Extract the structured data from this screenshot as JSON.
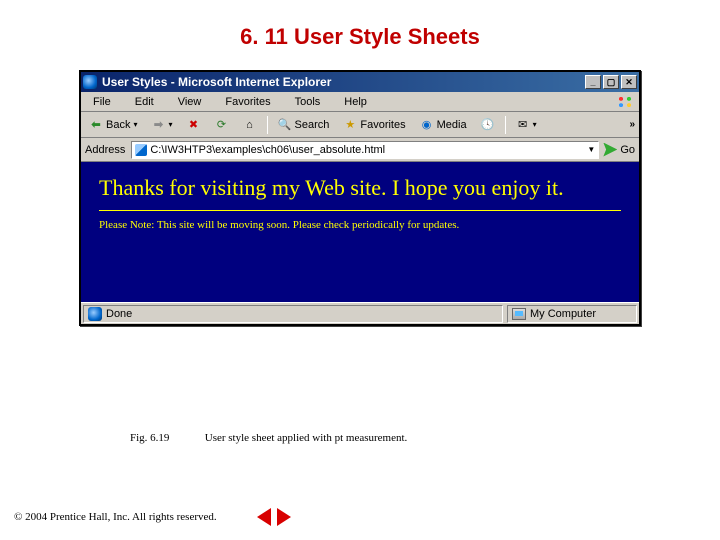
{
  "slide": {
    "title": "6. 11  User Style Sheets"
  },
  "browser": {
    "title": "User Styles - Microsoft Internet Explorer",
    "menus": [
      "File",
      "Edit",
      "View",
      "Favorites",
      "Tools",
      "Help"
    ],
    "toolbar": {
      "back": "Back",
      "search": "Search",
      "favorites": "Favorites",
      "media": "Media",
      "overflow": "»"
    },
    "address": {
      "label": "Address",
      "value": "C:\\IW3HTP3\\examples\\ch06\\user_absolute.html",
      "go": "Go"
    },
    "page": {
      "heading": "Thanks for visiting my Web site. I hope you enjoy it.",
      "note": "Please Note: This site will be moving soon. Please check periodically for updates."
    },
    "status": {
      "left": "Done",
      "right": "My Computer"
    }
  },
  "caption": {
    "fig": "Fig. 6.19",
    "text": "User style sheet applied with pt measurement."
  },
  "footer": {
    "copyright": "© 2004 Prentice Hall, Inc. All rights reserved."
  }
}
